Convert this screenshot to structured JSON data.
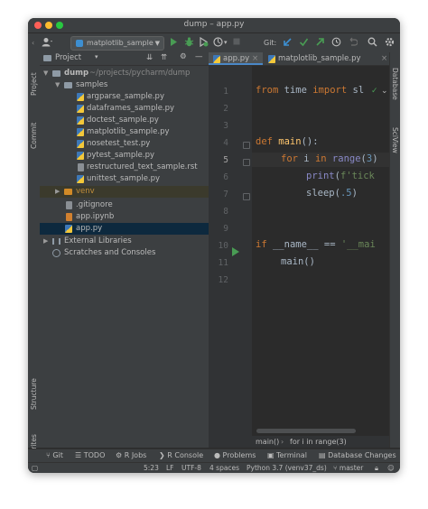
{
  "window": {
    "title": "dump – app.py"
  },
  "toolbar": {
    "run_config": "matplotlib_sample",
    "git_label": "Git:"
  },
  "project_panel": {
    "header": "Project",
    "side_tab_project": "Project",
    "side_tab_commit": "Commit",
    "side_tab_structure": "Structure",
    "side_tab_favorites": "Favorites",
    "root": {
      "name": "dump",
      "path": "~/projects/pycharm/dump"
    },
    "samples_folder": "samples",
    "sample_files": [
      "argparse_sample.py",
      "dataframes_sample.py",
      "doctest_sample.py",
      "matplotlib_sample.py",
      "nosetest_test.py",
      "pytest_sample.py",
      "restructured_text_sample.rst",
      "unittest_sample.py"
    ],
    "venv": "venv",
    "root_files": [
      ".gitignore",
      "app.ipynb",
      "app.py"
    ],
    "external_libraries": "External Libraries",
    "scratches": "Scratches and Consoles"
  },
  "editor": {
    "tabs": [
      {
        "label": "app.py",
        "active": true
      },
      {
        "label": "matplotlib_sample.py",
        "active": false
      }
    ],
    "line_numbers": [
      "1",
      "2",
      "3",
      "4",
      "5",
      "6",
      "7",
      "8",
      "9",
      "10",
      "11",
      "12"
    ],
    "current_line": 5,
    "lines": {
      "l1_kw1": "from",
      "l1_mod": " time ",
      "l1_kw2": "import",
      "l1_rest": " sl",
      "l4_kw": "def",
      "l4_fn": " main",
      "l4_rest": "():",
      "l5_kw": "for",
      "l5_a": " i ",
      "l5_in": "in",
      "l5_b": " ",
      "l5_range": "range",
      "l5_c": "(",
      "l5_num": "3",
      "l5_d": ")",
      "l6_fn": "print",
      "l6_a": "(",
      "l6_str": "f'tick",
      "l7_a": "sleep(",
      "l7_num": ".5",
      "l7_b": ")",
      "l10_kw": "if",
      "l10_a": " __name__ == ",
      "l10_str": "'__mai",
      "l11": "main()"
    },
    "breadcrumb": [
      "main()",
      "for i in range(3)"
    ],
    "right_tab_database": "Database",
    "right_tab_sciview": "SciView"
  },
  "tool_windows": [
    "Git",
    "TODO",
    "R Jobs",
    "R Console",
    "Problems",
    "Terminal",
    "Database Changes"
  ],
  "status_bar": {
    "position": "5:23",
    "line_sep": "LF",
    "encoding": "UTF-8",
    "indent": "4 spaces",
    "interpreter": "Python 3.7 (venv37_ds)",
    "branch": "master"
  }
}
